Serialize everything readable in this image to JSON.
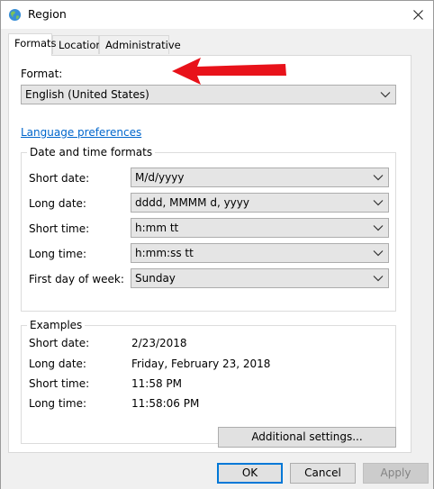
{
  "window": {
    "title": "Region",
    "close_glyph": "×"
  },
  "tabs": [
    {
      "label": "Formats",
      "active": true
    },
    {
      "label": "Location",
      "active": false
    },
    {
      "label": "Administrative",
      "active": false
    }
  ],
  "format": {
    "label": "Format:",
    "value": "English (United States)"
  },
  "language_link": "Language preferences",
  "datetime": {
    "group_title": "Date and time formats",
    "rows": [
      {
        "label": "Short date:",
        "value": "M/d/yyyy"
      },
      {
        "label": "Long date:",
        "value": "dddd, MMMM d, yyyy"
      },
      {
        "label": "Short time:",
        "value": "h:mm tt"
      },
      {
        "label": "Long time:",
        "value": "h:mm:ss tt"
      },
      {
        "label": "First day of week:",
        "value": "Sunday"
      }
    ]
  },
  "examples": {
    "group_title": "Examples",
    "rows": [
      {
        "label": "Short date:",
        "value": "2/23/2018"
      },
      {
        "label": "Long date:",
        "value": "Friday, February 23, 2018"
      },
      {
        "label": "Short time:",
        "value": "11:58 PM"
      },
      {
        "label": "Long time:",
        "value": "11:58:06 PM"
      }
    ]
  },
  "buttons": {
    "additional": "Additional settings...",
    "ok": "OK",
    "cancel": "Cancel",
    "apply": "Apply"
  },
  "icons": {
    "title": "globe-icon",
    "close": "close-icon",
    "dropdown": "chevron-down-icon",
    "annotation": "red-arrow-icon"
  },
  "colors": {
    "link": "#0066cc",
    "default_button_border": "#0078d7",
    "annotation_arrow": "#e8121a"
  }
}
